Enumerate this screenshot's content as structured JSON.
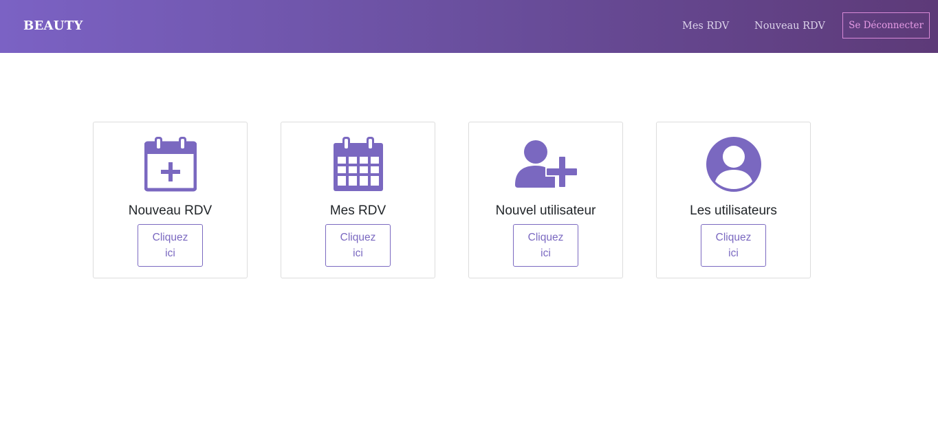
{
  "navbar": {
    "brand": "BEAUTY",
    "links": [
      {
        "label": "Mes RDV"
      },
      {
        "label": "Nouveau RDV"
      }
    ],
    "logout_label": "Se Déconnecter"
  },
  "cards": [
    {
      "title": "Nouveau RDV",
      "icon": "calendar-plus-icon",
      "button_line1": "Cliquez",
      "button_line2": "ici"
    },
    {
      "title": "Mes RDV",
      "icon": "calendar-grid-icon",
      "button_line1": "Cliquez",
      "button_line2": "ici"
    },
    {
      "title": "Nouvel utilisateur",
      "icon": "user-plus-icon",
      "button_line1": "Cliquez",
      "button_line2": "ici"
    },
    {
      "title": "Les utilisateurs",
      "icon": "user-circle-icon",
      "button_line1": "Cliquez",
      "button_line2": "ici"
    }
  ],
  "colors": {
    "accent": "#7a68c0",
    "navbar_start": "#7b62c4",
    "navbar_end": "#5d3a78",
    "logout_border": "#d98ad8"
  }
}
